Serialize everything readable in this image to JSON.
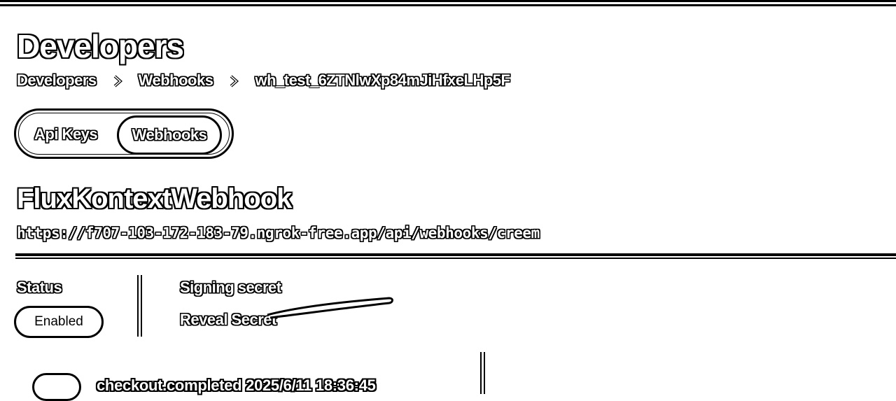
{
  "header": {
    "title": "Developers"
  },
  "breadcrumb": {
    "items": [
      "Developers",
      "Webhooks",
      "wh_test_6ZTNlwXp84mJiHfxeLHp5F"
    ],
    "separator_icon": "chevron-right-icon"
  },
  "tabs": [
    {
      "label": "Api Keys",
      "active": false
    },
    {
      "label": "Webhooks",
      "active": true
    }
  ],
  "webhook": {
    "name": "FluxKontextWebhook",
    "url": "https://f707-103-172-183-79.ngrok-free.app/api/webhooks/creem"
  },
  "details": {
    "status_label": "Status",
    "status_value": "Enabled",
    "signing_secret_label": "Signing secret",
    "reveal_secret_label": "Reveal Secret"
  },
  "footer_row": {
    "partial_text": "checkout.completed 2025/6/11 18:36:45"
  },
  "colors": {
    "background": "#ffffff",
    "foreground": "#000000"
  }
}
